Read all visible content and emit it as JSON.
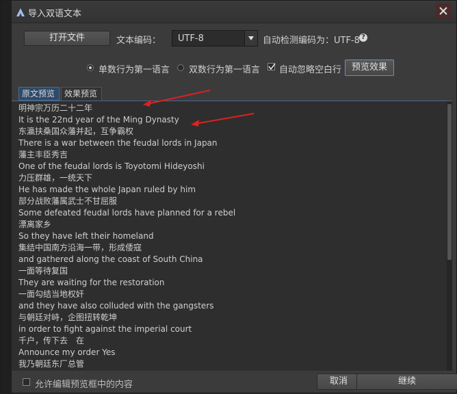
{
  "window": {
    "title": "导入双语文本"
  },
  "toolbar": {
    "open_file_label": "打开文件",
    "encoding_label": "文本编码：",
    "encoding_value": "UTF-8",
    "autodetect_label": "自动检测编码为：UTF-8"
  },
  "options": {
    "odd_first_label": "单数行为第一语言",
    "odd_first_selected": true,
    "even_first_label": "双数行为第一语言",
    "even_first_selected": false,
    "ignore_blank_label": "自动忽略空白行",
    "ignore_blank_checked": true,
    "preview_button_label": "预览效果"
  },
  "tabs": [
    {
      "label": "原文预览",
      "active": true
    },
    {
      "label": "效果预览",
      "active": false
    }
  ],
  "preview_lines": [
    "明神宗万历二十二年",
    "It is the 22nd year of the Ming Dynasty",
    "东瀛扶桑国众藩并起，互争霸权",
    "There is a war between the feudal lords in Japan",
    "藩主丰臣秀吉",
    "One of the feudal lords is Toyotomi Hideyoshi",
    "力压群雄，一统天下",
    "He has made the whole Japan ruled by him",
    "部分战败藩属武士不甘屈服",
    "Some defeated feudal lords have planned for a rebel",
    "漂离家乡",
    "So they have left their homeland",
    "集结中国南方沿海一带，形成倭寇",
    "and gathered along the coast of South China",
    "一面等待复国",
    "They are waiting for the restoration",
    "一面勾结当地权奸",
    "and they have also colluded with the gangsters",
    "与朝廷对峙，企图扭转乾坤",
    "in order to fight against the imperial court",
    "千户，传下去　在",
    "Announce my order Yes",
    "我乃朝廷东厂总管"
  ],
  "footer": {
    "allow_edit_label": "允许编辑预览框中的内容",
    "allow_edit_checked": false,
    "cancel_label": "取消",
    "continue_label": "继续"
  },
  "colors": {
    "annotation_arrow": "#e02020",
    "tab_active_bg": "#2e4a6a"
  }
}
